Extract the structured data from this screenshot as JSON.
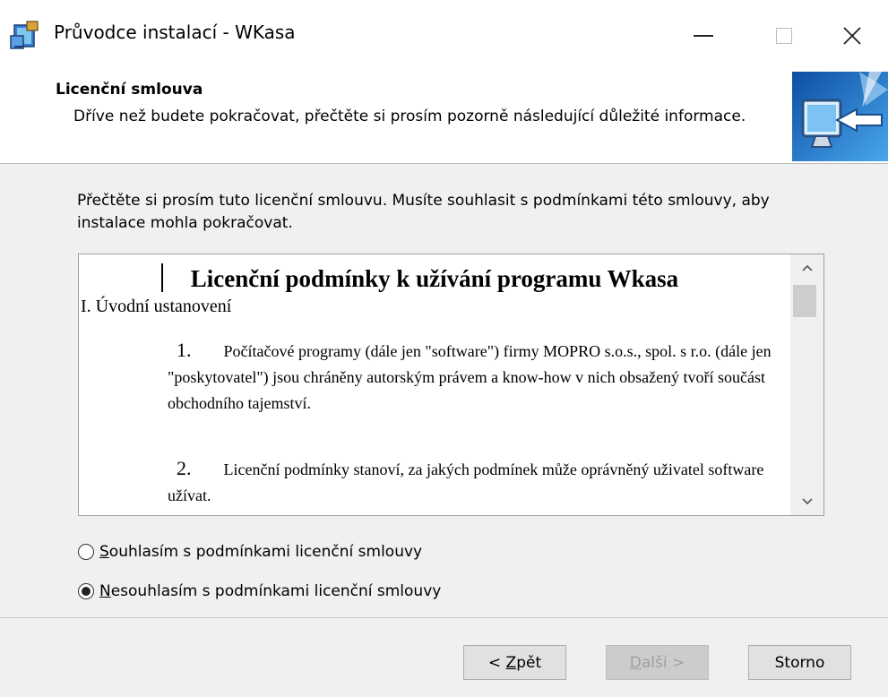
{
  "window": {
    "title": "Průvodce instalací - WKasa",
    "icons": {
      "app": "installer-box-icon",
      "minimize": "minimize-icon",
      "maximize": "maximize-icon",
      "close": "close-icon"
    }
  },
  "header": {
    "title": "Licenční smlouva",
    "description": "Dříve než budete pokračovat, přečtěte si prosím pozorně následující důležité informace.",
    "image_icon": "monitor-arrow-icon"
  },
  "intro": "Přečtěte si prosím tuto licenční smlouvu. Musíte souhlasit s podmínkami této smlouvy, aby instalace mohla pokračovat.",
  "license": {
    "title": "Licenční podmínky k užívání programu Wkasa",
    "section": "I. Úvodní ustanovení",
    "paragraphs": [
      {
        "number": "1.",
        "text": "Počítačové programy (dále jen \"software\") firmy MOPRO s.o.s., spol. s r.o. (dále jen \"poskytovatel\") jsou chráněny autorským právem a know-how v nich obsažený tvoří součást obchodního tajemství."
      },
      {
        "number": "2.",
        "text": "Licenční podmínky stanoví, za jakých podmínek může oprávněný uživatel software užívat."
      }
    ]
  },
  "options": {
    "agree": {
      "label_underline": "S",
      "label_rest": "ouhlasím s podmínkami licenční smlouvy",
      "selected": false
    },
    "disagree": {
      "label_underline": "N",
      "label_rest": "esouhlasím s podmínkami licenční smlouvy",
      "selected": true
    }
  },
  "buttons": {
    "back": {
      "prefix": "< ",
      "underline": "Z",
      "rest": "pět"
    },
    "next": {
      "underline": "D",
      "rest": "alší >",
      "disabled": true
    },
    "cancel": "Storno"
  }
}
